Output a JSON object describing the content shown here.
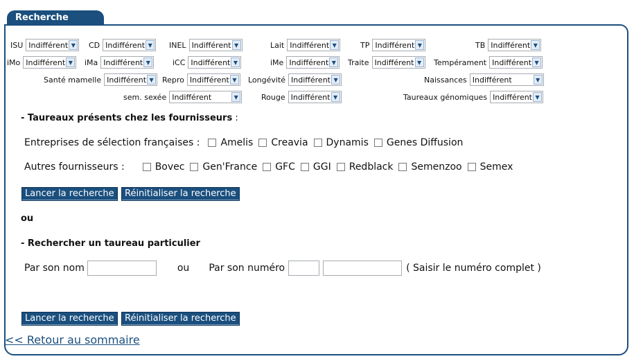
{
  "tab_title": "Recherche",
  "filters": {
    "isu": {
      "label": "ISU",
      "value": "Indifférent"
    },
    "cd": {
      "label": "CD",
      "value": "Indifférent"
    },
    "inel": {
      "label": "INEL",
      "value": "Indifférent"
    },
    "lait": {
      "label": "Lait",
      "value": "Indifférent"
    },
    "tp": {
      "label": "TP",
      "value": "Indifférent"
    },
    "tb": {
      "label": "TB",
      "value": "Indifférent"
    },
    "imo": {
      "label": "iMo",
      "value": "Indifférent"
    },
    "ima": {
      "label": "iMa",
      "value": "Indifférent"
    },
    "icc": {
      "label": "iCC",
      "value": "Indifférent"
    },
    "ime": {
      "label": "iMe",
      "value": "Indifférent"
    },
    "traite": {
      "label": "Traite",
      "value": "Indifférent"
    },
    "temperament": {
      "label": "Tempérament",
      "value": "Indifférent"
    },
    "sante_mamelle": {
      "label": "Santé mamelle",
      "value": "Indifférent"
    },
    "repro": {
      "label": "Repro",
      "value": "Indifférent"
    },
    "longevite": {
      "label": "Longévité",
      "value": "Indifférent"
    },
    "naissances": {
      "label": "Naissances",
      "value": "Indifférent"
    },
    "sem_sexee": {
      "label": "sem. sexée",
      "value": "Indifférent"
    },
    "rouge": {
      "label": "Rouge",
      "value": "Indifférent"
    },
    "taureaux_genomiques": {
      "label": "Taureaux génomiques",
      "value": "Indifférent"
    }
  },
  "suppliers": {
    "title": "- Taureaux présents chez les fournisseurs",
    "title_suffix": " :",
    "french_label": "Entreprises de sélection françaises :",
    "french": [
      "Amelis",
      "Creavia",
      "Dynamis",
      "Genes Diffusion"
    ],
    "other_label": "Autres fournisseurs :",
    "other": [
      "Bovec",
      "Gen'France",
      "GFC",
      "GGI",
      "Redblack",
      "Semenzoo",
      "Semex"
    ]
  },
  "buttons": {
    "search": "Lancer la recherche",
    "reset": "Réinitialiser la recherche"
  },
  "or_text": "ou",
  "particular": {
    "title": "- Rechercher un taureau particulier",
    "by_name_label": "Par son nom",
    "or_inline": "ou",
    "by_number_label": "Par son numéro",
    "hint": "( Saisir le numéro complet )"
  },
  "back_link": "<< Retour au sommaire"
}
